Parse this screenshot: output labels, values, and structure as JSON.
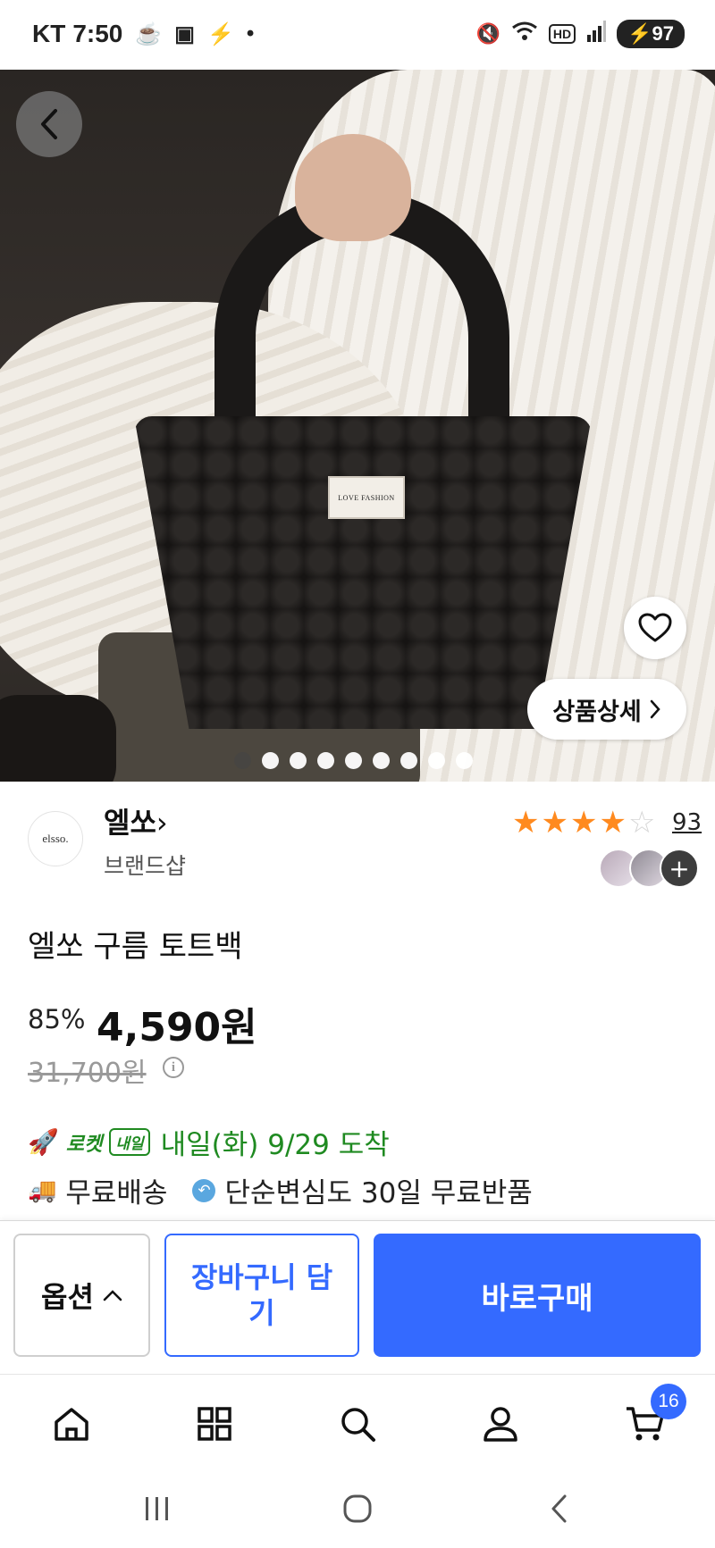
{
  "status_bar": {
    "carrier": "KT",
    "time": "7:50",
    "hd_label": "HD",
    "battery": "97"
  },
  "hero": {
    "bag_label": "LOVE FASHION",
    "detail_button": "상품상세",
    "image_count": 9,
    "active_index": 0
  },
  "seller": {
    "logo_text": "elsso.",
    "name": "엘쏘",
    "type": "브랜드샵",
    "rating": 4.5,
    "review_count": "93"
  },
  "product": {
    "title": "엘쏘 구름 토트백",
    "discount": "85%",
    "price": "4,590원",
    "original_price": "31,700원"
  },
  "delivery": {
    "rocket_label": "로켓",
    "rocket_badge": "내일",
    "arrival": "내일(화) 9/29 도착",
    "free_shipping": "무료배송",
    "return_policy": "단순변심도 30일 무료반품"
  },
  "actions": {
    "option": "옵션",
    "cart": "장바구니 담기",
    "buy": "바로구매"
  },
  "bottom_nav": {
    "items": [
      "home-icon",
      "category-icon",
      "search-icon",
      "profile-icon",
      "cart-icon"
    ],
    "cart_count": "16"
  },
  "colors": {
    "accent": "#346aff",
    "rocket_green": "#1f8a21",
    "star": "#ff8a1f"
  }
}
